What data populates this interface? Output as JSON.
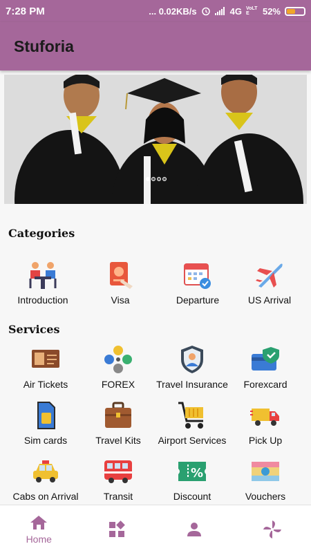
{
  "status_bar": {
    "time": "7:28 PM",
    "signal_text": "... 0.02KB/s",
    "network": "4G",
    "volte": "VoLTE",
    "battery_text": "52%",
    "battery_level": 0.52
  },
  "app": {
    "title": "Stuforia"
  },
  "banner": {
    "slide_count": 4,
    "active_slide": 0
  },
  "categories": {
    "heading": "Categories",
    "items": [
      {
        "label": "Introduction",
        "icon": "meeting-icon"
      },
      {
        "label": "Visa",
        "icon": "passport-icon"
      },
      {
        "label": "Departure",
        "icon": "calendar-icon"
      },
      {
        "label": "US Arrival",
        "icon": "airplane-icon"
      }
    ]
  },
  "services": {
    "heading": "Services",
    "items": [
      {
        "label": "Air Tickets",
        "icon": "ticket-icon"
      },
      {
        "label": "FOREX",
        "icon": "currency-exchange-icon"
      },
      {
        "label": "Travel Insurance",
        "icon": "insurance-shield-icon"
      },
      {
        "label": "Forexcard",
        "icon": "forex-card-icon"
      },
      {
        "label": "Sim cards",
        "icon": "sim-card-icon"
      },
      {
        "label": "Travel Kits",
        "icon": "briefcase-icon"
      },
      {
        "label": "Airport Services",
        "icon": "luggage-cart-icon"
      },
      {
        "label": "Pick Up",
        "icon": "delivery-truck-icon"
      },
      {
        "label": "Cabs on Arrival",
        "icon": "taxi-icon"
      },
      {
        "label": "Transit",
        "icon": "bus-icon"
      },
      {
        "label": "Discount",
        "icon": "discount-icon"
      },
      {
        "label": "Vouchers",
        "icon": "voucher-icon"
      }
    ]
  },
  "bottom_nav": {
    "items": [
      {
        "label": "Home",
        "icon": "home-icon",
        "active": true
      },
      {
        "label": "",
        "icon": "widgets-icon",
        "active": false
      },
      {
        "label": "",
        "icon": "profile-icon",
        "active": false
      },
      {
        "label": "",
        "icon": "pinwheel-icon",
        "active": false
      }
    ]
  },
  "colors": {
    "primary": "#a5679a",
    "background": "#f7f7f7",
    "battery": "#f0a62a"
  }
}
